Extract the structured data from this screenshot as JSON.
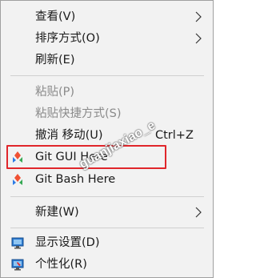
{
  "menu": {
    "items": [
      {
        "label": "查看(V)",
        "has_submenu": true
      },
      {
        "label": "排序方式(O)",
        "has_submenu": true
      },
      {
        "label": "刷新(E)"
      },
      {
        "label": "粘贴(P)",
        "disabled": true
      },
      {
        "label": "粘贴快捷方式(S)",
        "disabled": true
      },
      {
        "label": "撤消 移动(U)",
        "shortcut": "Ctrl+Z"
      },
      {
        "label": "Git GUI Here",
        "icon": "git-icon"
      },
      {
        "label": "Git Bash Here",
        "icon": "git-icon"
      },
      {
        "label": "新建(W)",
        "has_submenu": true
      },
      {
        "label": "显示设置(D)",
        "icon": "display-settings-icon"
      },
      {
        "label": "个性化(R)",
        "icon": "personalize-icon"
      }
    ]
  },
  "watermark": "guanjiaxiao_e",
  "colors": {
    "menu_bg": "#f2f2f2",
    "highlight_border": "#e0262b",
    "disabled_text": "#8a8a8a"
  }
}
